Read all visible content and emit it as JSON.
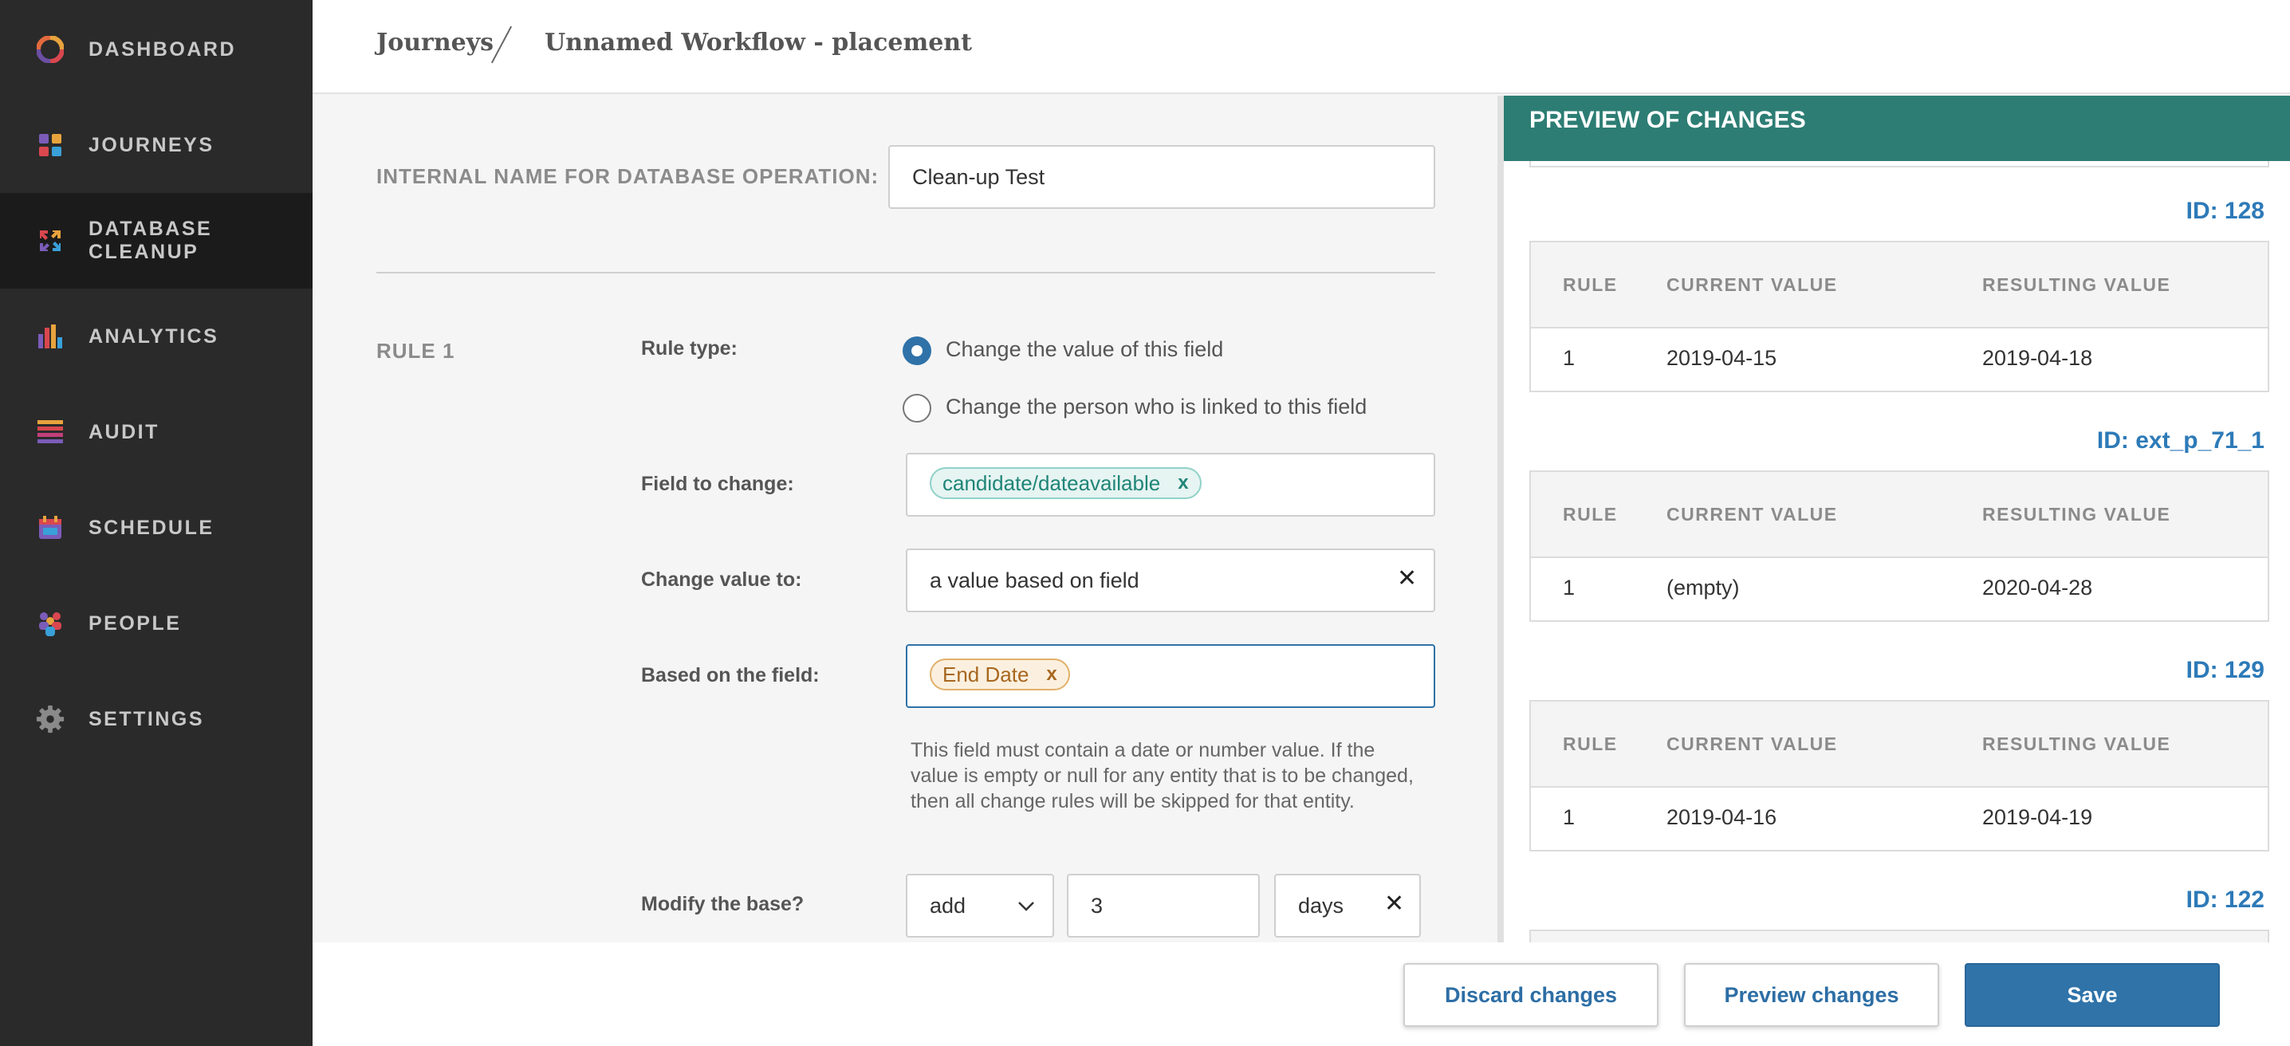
{
  "sidebar": {
    "items": [
      {
        "label": "DASHBOARD",
        "icon": "dashboard-ring-icon"
      },
      {
        "label": "JOURNEYS",
        "icon": "journeys-grid-icon"
      },
      {
        "label": "DATABASE CLEANUP",
        "icon": "database-cleanup-arrows-icon"
      },
      {
        "label": "ANALYTICS",
        "icon": "bar-chart-icon"
      },
      {
        "label": "AUDIT",
        "icon": "list-icon"
      },
      {
        "label": "SCHEDULE",
        "icon": "calendar-icon"
      },
      {
        "label": "PEOPLE",
        "icon": "people-icon"
      },
      {
        "label": "SETTINGS",
        "icon": "gear-icon"
      }
    ],
    "active": "DATABASE CLEANUP"
  },
  "header": {
    "breadcrumb_root": "Journeys",
    "breadcrumb_current": "Unnamed Workflow - placement"
  },
  "form": {
    "internal_name_label": "INTERNAL NAME FOR DATABASE OPERATION:",
    "internal_name_value": "Clean-up Test",
    "rule_label": "RULE 1",
    "rule_type_label": "Rule type:",
    "rule_type_options": [
      "Change the value of this field",
      "Change the person who is linked to this field"
    ],
    "rule_type_selected": "Change the value of this field",
    "field_to_change_label": "Field to change:",
    "field_to_change_tag": "candidate/dateavailable",
    "change_value_to_label": "Change value to:",
    "change_value_to_value": "a value based on field",
    "based_on_label": "Based on the field:",
    "based_on_tag": "End Date",
    "help_text": "This field must contain a date or number value. If the value is empty or null for any entity that is to be changed, then all change rules will be skipped for that entity.",
    "modify_base_label": "Modify the base?",
    "modify_operation": "add",
    "modify_amount": "3",
    "modify_unit": "days",
    "tag_remove": "x"
  },
  "preview": {
    "title": "PREVIEW OF CHANGES",
    "columns": [
      "RULE",
      "CURRENT VALUE",
      "RESULTING VALUE"
    ],
    "records": [
      {
        "id": "ID: 128",
        "rows": [
          {
            "rule": "1",
            "current": "2019-04-15",
            "resulting": "2019-04-18"
          }
        ]
      },
      {
        "id": "ID: ext_p_71_1",
        "rows": [
          {
            "rule": "1",
            "current": "(empty)",
            "resulting": "2020-04-28"
          }
        ]
      },
      {
        "id": "ID: 129",
        "rows": [
          {
            "rule": "1",
            "current": "2019-04-16",
            "resulting": "2019-04-19"
          }
        ]
      },
      {
        "id": "ID: 122",
        "rows": []
      }
    ]
  },
  "footer": {
    "discard_label": "Discard changes",
    "preview_label": "Preview changes",
    "save_label": "Save"
  },
  "colors": {
    "sidebar_bg": "#2a2a2a",
    "accent_teal": "#2d7d74",
    "primary_blue": "#2f73a9",
    "id_blue": "#2d7ab8"
  }
}
